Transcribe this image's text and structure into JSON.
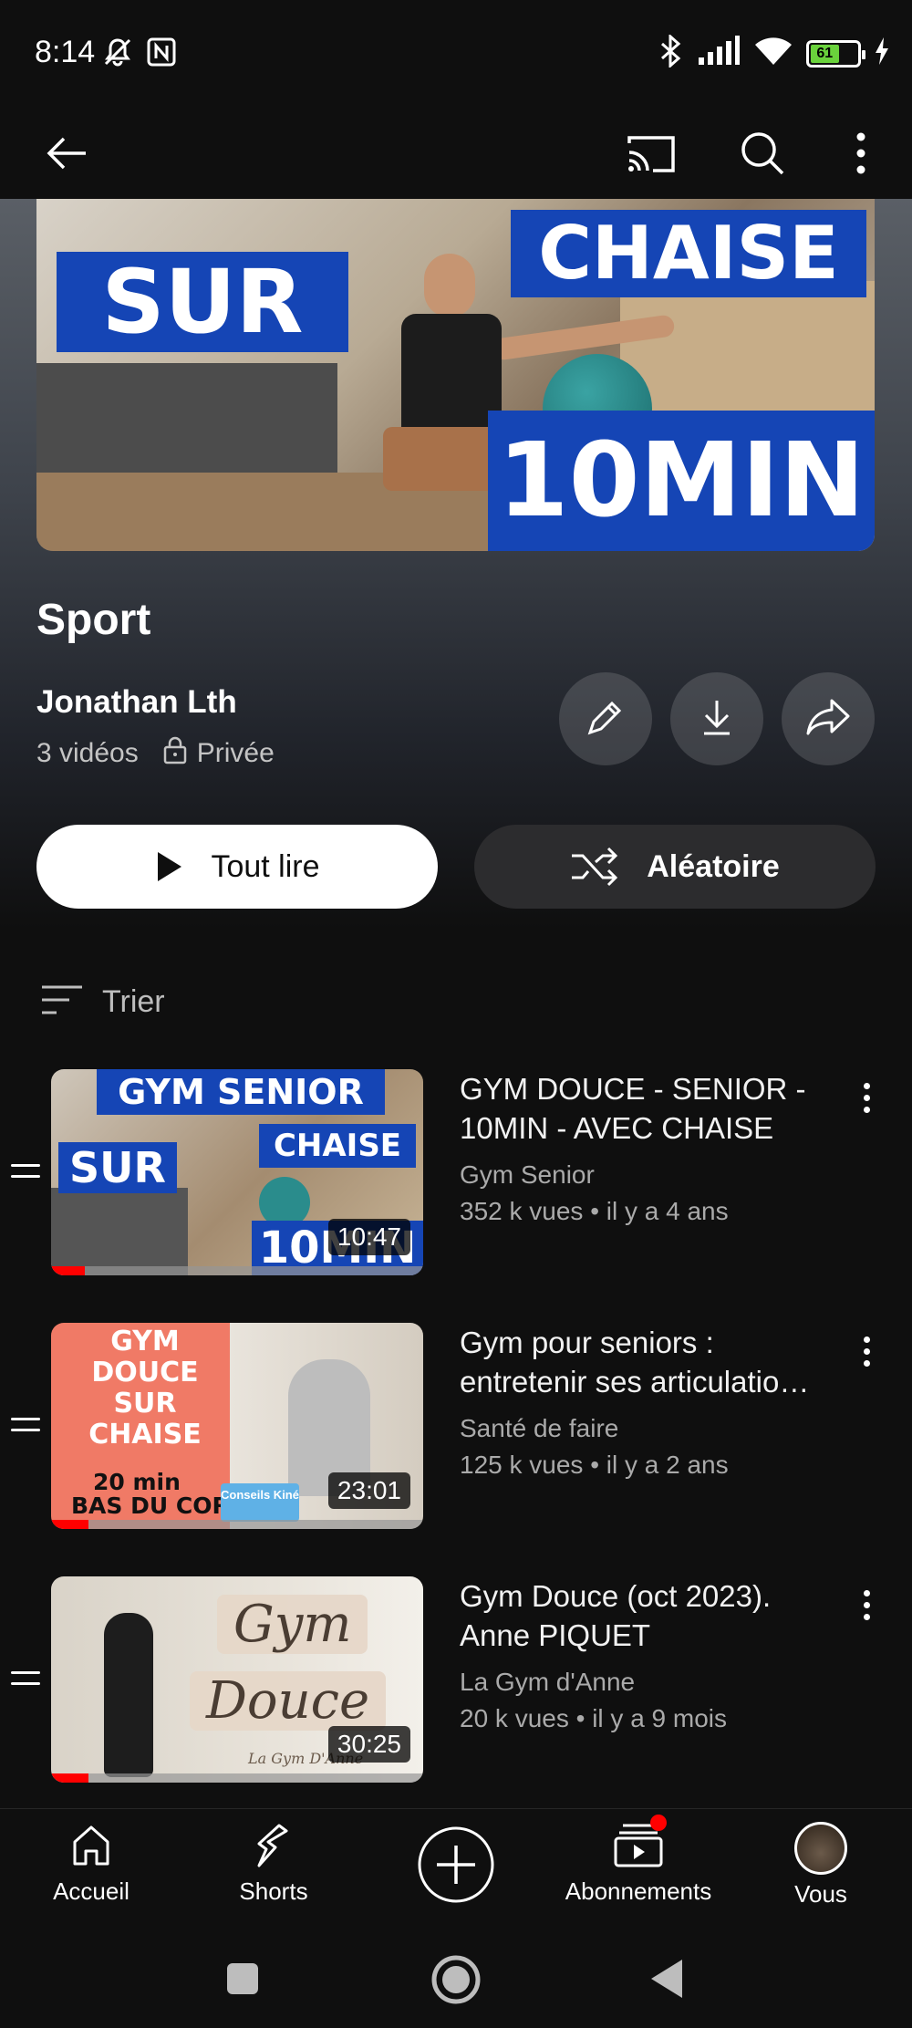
{
  "status_bar": {
    "time": "8:14",
    "battery": "61"
  },
  "header": {
    "icons": [
      "back-arrow-icon",
      "cast-icon",
      "search-icon",
      "more-vert-icon"
    ]
  },
  "playlist": {
    "thumbnail_text": {
      "left": "SUR",
      "top": "CHAISE",
      "bottom": "10MIN"
    },
    "title": "Sport",
    "owner": "Jonathan Lth",
    "video_count": "3 vidéos",
    "privacy": "Privée",
    "play_all_label": "Tout lire",
    "shuffle_label": "Aléatoire"
  },
  "sort": {
    "label": "Trier"
  },
  "videos": [
    {
      "title": "GYM DOUCE - SENIOR - 10MIN - AVEC CHAISE",
      "channel": "Gym Senior",
      "stats": "352 k vues • il y a 4 ans",
      "duration": "10:47",
      "watched_fraction": 0.09,
      "thumb_text": {
        "top": "GYM SENIOR",
        "left": "SUR",
        "right": "CHAISE",
        "bottom": "10MIN"
      }
    },
    {
      "title": "Gym pour seniors : entretenir ses articulatio…",
      "channel": "Santé de faire",
      "stats": "125 k vues • il y a 2 ans",
      "duration": "23:01",
      "watched_fraction": 0.1,
      "thumb_text": {
        "main": "GYM DOUCE SUR CHAISE",
        "sub1": "20 min",
        "sub2": "BAS DU CORPS",
        "tag": "Conseils Kiné"
      }
    },
    {
      "title": "Gym Douce (oct 2023). Anne PIQUET",
      "channel": "La Gym d'Anne",
      "stats": "20 k vues • il y a 9 mois",
      "duration": "30:25",
      "watched_fraction": 0.1,
      "thumb_text": {
        "word1": "Gym",
        "word2": "Douce",
        "signature": "La Gym D'Anne"
      }
    }
  ],
  "bottom_nav": {
    "items": [
      {
        "label": "Accueil",
        "icon": "home-icon"
      },
      {
        "label": "Shorts",
        "icon": "shorts-icon"
      },
      {
        "label": "",
        "icon": "create-plus-icon"
      },
      {
        "label": "Abonnements",
        "icon": "subscriptions-icon"
      },
      {
        "label": "Vous",
        "icon": "avatar"
      }
    ]
  },
  "colors": {
    "background": "#0f0f0f",
    "accent_red": "#ff0000",
    "thumbnail_blue": "#1545b5"
  }
}
